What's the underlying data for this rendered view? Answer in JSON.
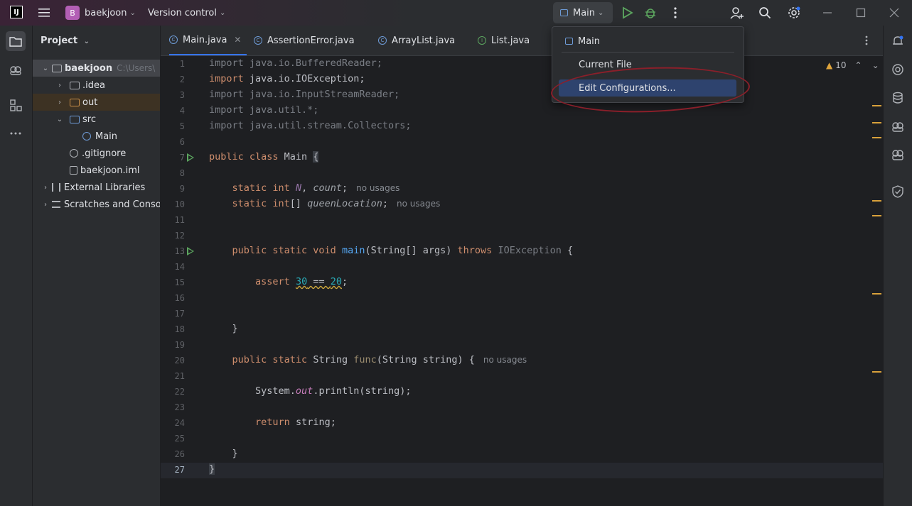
{
  "titlebar": {
    "logo": "IJ",
    "project_badge": "B",
    "project_name": "baekjoon",
    "vcs": "Version control",
    "run_config": "Main"
  },
  "project_panel": {
    "title": "Project",
    "tree": [
      {
        "label": "baekjoon",
        "suffix": "C:\\Users\\"
      },
      {
        "label": ".idea"
      },
      {
        "label": "out"
      },
      {
        "label": "src"
      },
      {
        "label": "Main"
      },
      {
        "label": ".gitignore"
      },
      {
        "label": "baekjoon.iml"
      },
      {
        "label": "External Libraries"
      },
      {
        "label": "Scratches and Conso"
      }
    ]
  },
  "tabs": [
    {
      "label": "Main.java"
    },
    {
      "label": "AssertionError.java"
    },
    {
      "label": "ArrayList.java"
    },
    {
      "label": "List.java"
    }
  ],
  "editor": {
    "warnings_count": "10",
    "line_numbers": [
      "1",
      "2",
      "3",
      "4",
      "5",
      "6",
      "7",
      "8",
      "9",
      "10",
      "11",
      "12",
      "13",
      "14",
      "15",
      "16",
      "17",
      "18",
      "19",
      "20",
      "21",
      "22",
      "23",
      "24",
      "25",
      "26",
      "27"
    ],
    "hints": {
      "no_usages": "no usages"
    }
  },
  "dropdown": {
    "items": [
      {
        "label": "Main"
      },
      {
        "label": "Current File"
      },
      {
        "label": "Edit Configurations..."
      }
    ]
  },
  "colors": {
    "accent": "#3574f0",
    "highlight": "#2e436e",
    "annotation": "#8b1f2a"
  }
}
